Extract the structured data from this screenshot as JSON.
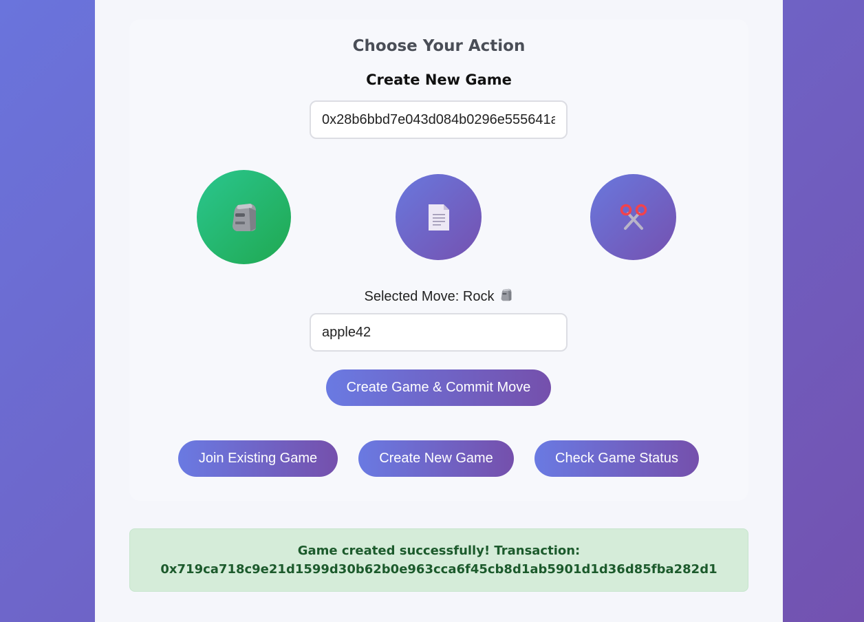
{
  "action_panel": {
    "title": "Choose Your Action",
    "subtitle": "Create New Game"
  },
  "opponent_input": {
    "value": "0x28b6bbd7e043d084b0296e555641a"
  },
  "moves": [
    {
      "name": "Rock",
      "icon": "rock-icon",
      "selected": true
    },
    {
      "name": "Paper",
      "icon": "paper-icon",
      "selected": false
    },
    {
      "name": "Scissors",
      "icon": "scissors-icon",
      "selected": false
    }
  ],
  "selected_move": {
    "label": "Selected Move: Rock",
    "icon": "rock-icon"
  },
  "secret_input": {
    "value": "apple42"
  },
  "buttons": {
    "create_commit": "Create Game & Commit Move",
    "join": "Join Existing Game",
    "create": "Create New Game",
    "status": "Check Game Status"
  },
  "status_message": {
    "line1": "Game created successfully! Transaction:",
    "line2": "0x719ca718c9e21d1599d30b62b0e963cca6f45cb8d1ab5901d1d36d85fba282d1"
  },
  "colors": {
    "selected_move": "#22b76b",
    "accent_start": "#6a7ae2",
    "accent_end": "#7550ac",
    "success_bg": "#d5ecd9",
    "success_text": "#1c5a2c"
  }
}
